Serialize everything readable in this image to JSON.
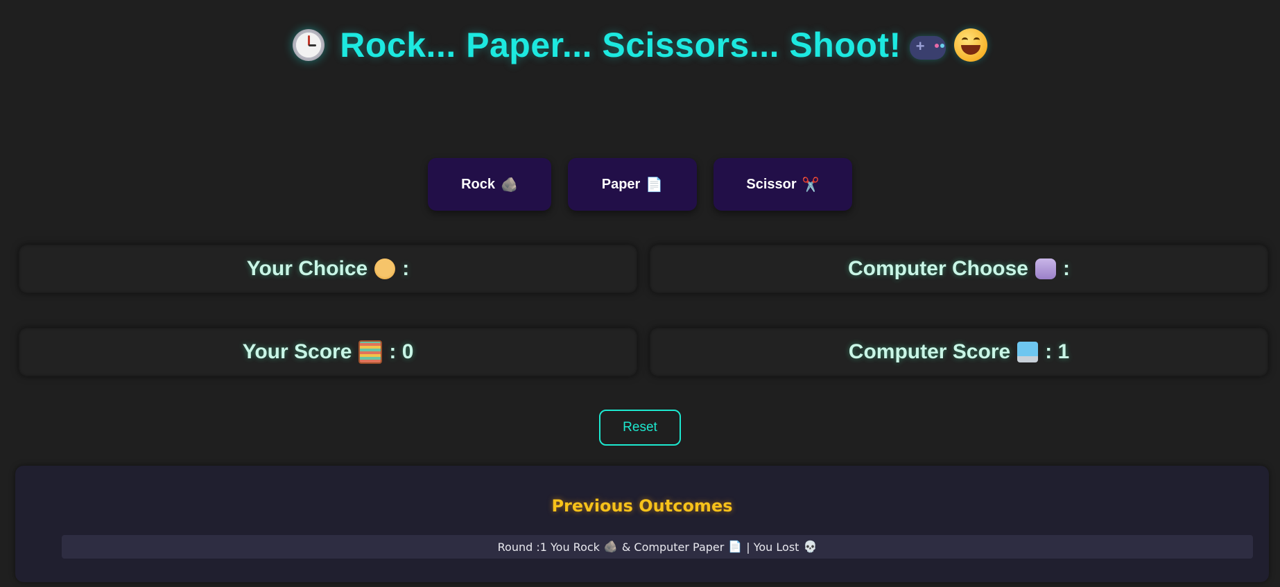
{
  "header": {
    "title": "Rock... Paper... Scissors... Shoot!",
    "icons": [
      "clock-icon",
      "gamepad-icon",
      "grinning-face-icon"
    ]
  },
  "choices": {
    "rock": {
      "label": "Rock",
      "emoji": "🪨"
    },
    "paper": {
      "label": "Paper",
      "emoji": "📄"
    },
    "scissor": {
      "label": "Scissor",
      "emoji": "✂️"
    }
  },
  "panels": {
    "your_choice": {
      "label": "Your Choice",
      "suffix": ":",
      "value": "",
      "icon": "person-icon"
    },
    "computer_choice": {
      "label": "Computer Choose",
      "suffix": ":",
      "value": "",
      "icon": "robot-icon"
    },
    "your_score": {
      "label": "Your Score",
      "suffix": ": 0",
      "value": 0,
      "icon": "abacus-icon"
    },
    "computer_score": {
      "label": "Computer Score",
      "suffix": ": 1",
      "value": 1,
      "icon": "laptop-icon"
    }
  },
  "reset": {
    "label": "Reset"
  },
  "history": {
    "title": "Previous Outcomes",
    "items": [
      {
        "text_a": "Round :1 You Rock",
        "emoji_a": "🪨",
        "text_b": "& Computer Paper",
        "emoji_b": "📄",
        "text_c": "| You Lost",
        "emoji_c": "💀"
      }
    ]
  },
  "colors": {
    "background": "#1f1f1f",
    "title": "#1de9e0",
    "button_bg": "#220f48",
    "panel_text": "#c9f5e6",
    "reset_border": "#1de9d0",
    "history_title": "#f7c21a",
    "history_bg": "#201f2f"
  }
}
